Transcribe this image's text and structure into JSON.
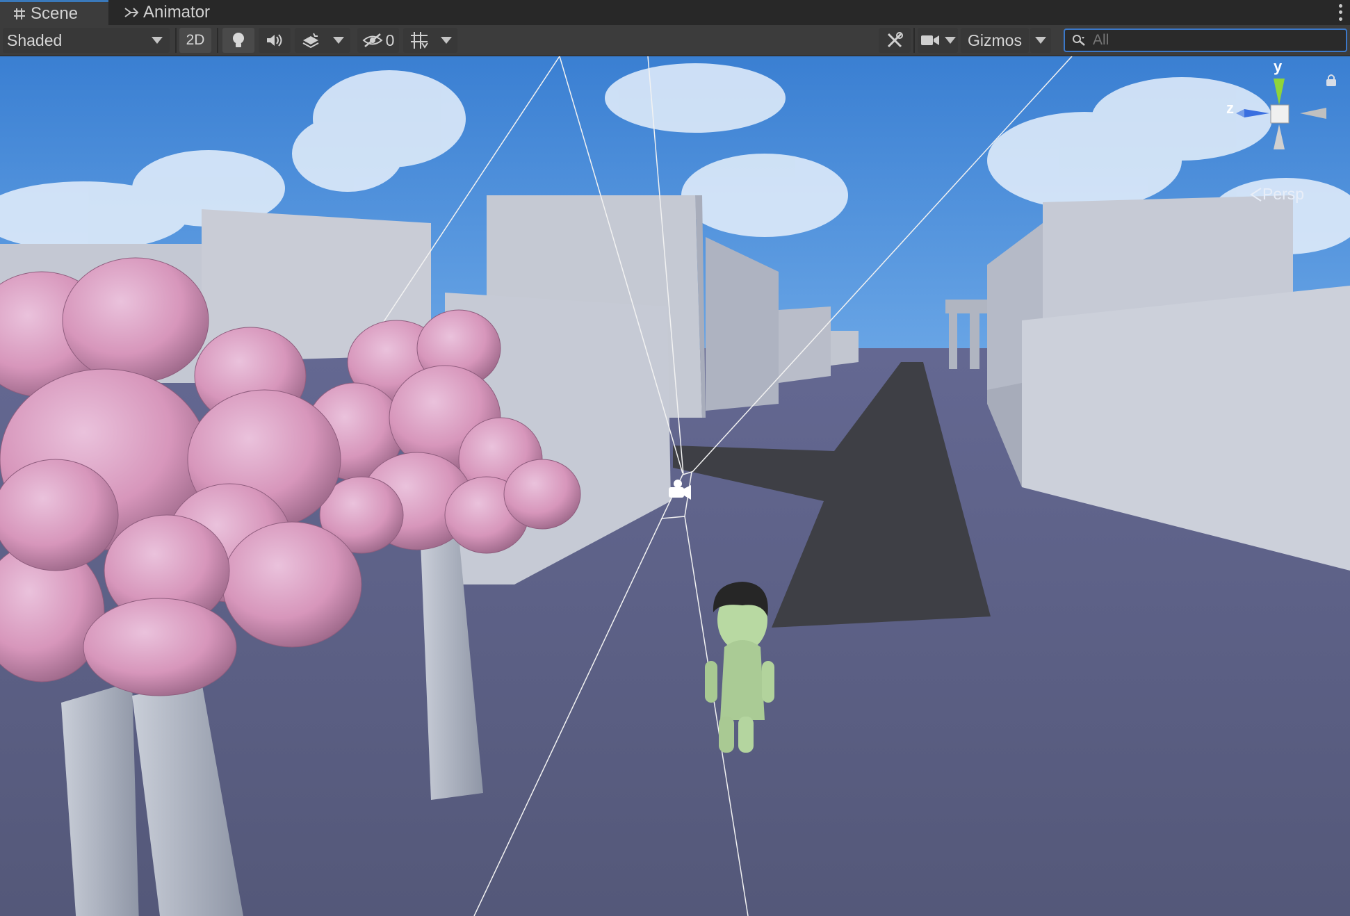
{
  "tabs": [
    {
      "label": "Scene",
      "icon": "grid-hash-icon",
      "active": true
    },
    {
      "label": "Animator",
      "icon": "animator-icon",
      "active": false
    }
  ],
  "toolbar": {
    "shading_mode": "Shaded",
    "mode_2d": "2D",
    "hidden_count": "0",
    "gizmos_label": "Gizmos",
    "search_placeholder": "All"
  },
  "viewport": {
    "axis_y": "y",
    "axis_z": "z",
    "projection_label": "Persp"
  },
  "colors": {
    "tab_accent": "#3a79bb",
    "search_border": "#3b78c9",
    "sky": "#3f86d6",
    "ground": "#5a5d84",
    "axis_y": "#8fd43a",
    "axis_z": "#3a6fe0"
  }
}
